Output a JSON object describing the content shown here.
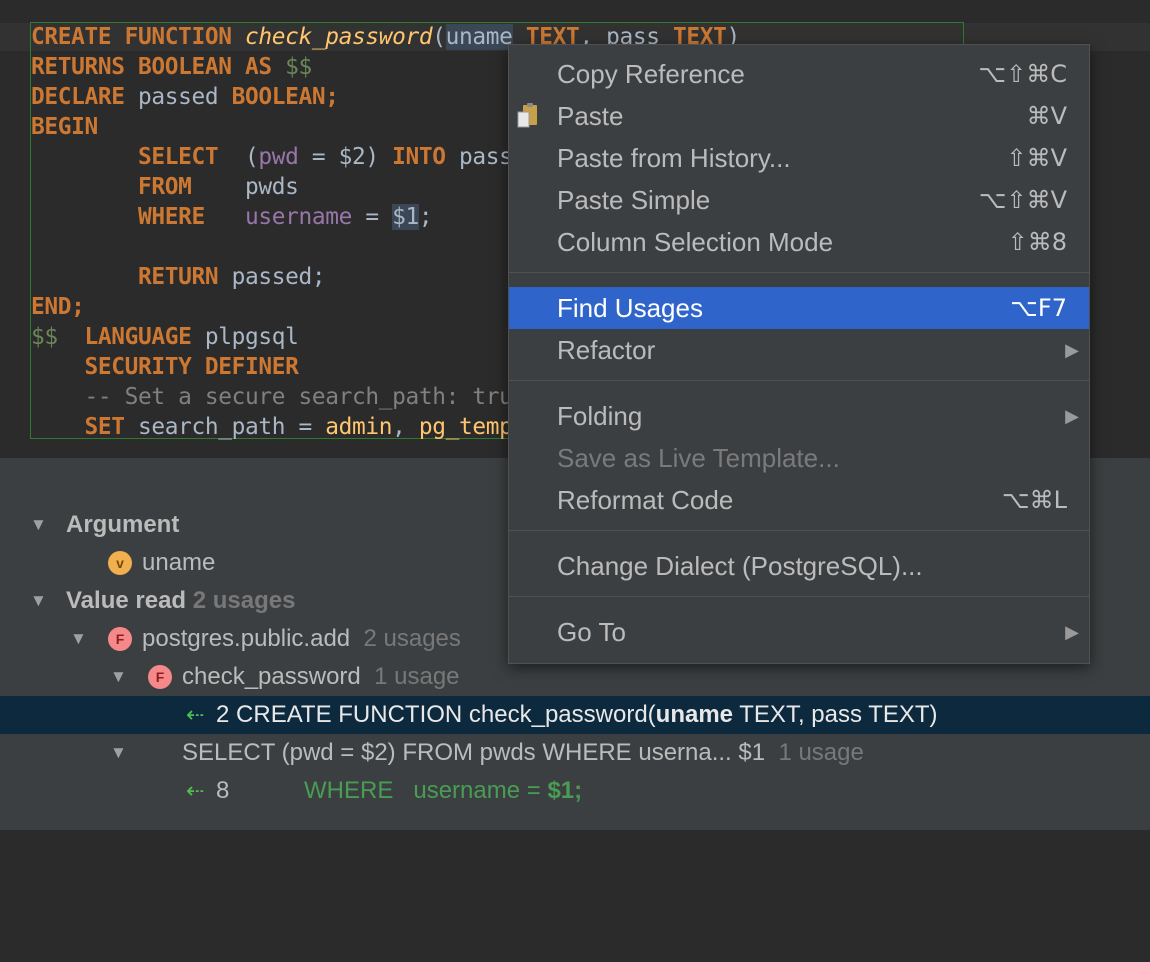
{
  "editor": {
    "lines": [
      {
        "kw1": "CREATE FUNCTION",
        "fn": "check_password",
        "p1": "(",
        "param": "uname",
        "kw2": "TEXT",
        "p2": ", pass ",
        "kw3": "TEXT",
        "p3": ")"
      },
      {
        "kw1": "RETURNS BOOLEAN AS",
        "dollar": "$$"
      },
      {
        "kw1": "DECLARE",
        "txt": "passed",
        "kw2": "BOOLEAN;"
      },
      {
        "kw1": "BEGIN"
      },
      {
        "kw1": "SELECT",
        "p1": "(",
        "col": "pwd",
        "p2": " = $2) ",
        "kw2": "INTO",
        "txt": " passed"
      },
      {
        "kw1": "FROM",
        "txt": "pwds"
      },
      {
        "kw1": "WHERE",
        "col": "username",
        "p1": " = ",
        "arg": "$1",
        "p2": ";"
      },
      {
        "kw1": "RETURN",
        "txt": "passed;"
      },
      {
        "kw1": "END;"
      },
      {
        "dollar": "$$",
        "kw1": "LANGUAGE",
        "txt": "plpgsql"
      },
      {
        "kw1": "SECURITY DEFINER"
      },
      {
        "cmt": "-- Set a secure search_path: trusted schema(s), then 'pg_temp'."
      },
      {
        "kw1": "SET",
        "txt": "search_path = ",
        "fn1": "admin",
        "p1": ", ",
        "fn2": "pg_temp",
        "p2": ";"
      }
    ]
  },
  "tree": {
    "argument_label": "Argument",
    "argument_item": "uname",
    "value_read_label": "Value read",
    "value_read_count": "2 usages",
    "func_add_name": "postgres.public.add",
    "func_add_count": "2 usages",
    "func_check_name": "check_password",
    "func_check_count": "1 usage",
    "usage1_line": "2",
    "usage1_pre": " CREATE FUNCTION check_password(",
    "usage1_bold": "uname",
    "usage1_post": " TEXT, pass TEXT)",
    "select_text": "SELECT (pwd = $2) FROM pwds WHERE userna... $1",
    "select_count": "1 usage",
    "usage2_line": "8",
    "usage2_where": "WHERE",
    "usage2_text": "username = ",
    "usage2_bold": "$1;"
  },
  "menu": {
    "items": [
      {
        "label": "Copy Reference",
        "shortcut": "⌥⇧⌘C"
      },
      {
        "label": "Paste",
        "shortcut": "⌘V"
      },
      {
        "label": "Paste from History...",
        "shortcut": "⇧⌘V"
      },
      {
        "label": "Paste Simple",
        "shortcut": "⌥⇧⌘V"
      },
      {
        "label": "Column Selection Mode",
        "shortcut": "⇧⌘8"
      },
      {
        "label": "Find Usages",
        "shortcut": "⌥F7"
      },
      {
        "label": "Refactor"
      },
      {
        "label": "Folding"
      },
      {
        "label": "Save as Live Template..."
      },
      {
        "label": "Reformat Code",
        "shortcut": "⌥⌘L"
      },
      {
        "label": "Change Dialect (PostgreSQL)..."
      },
      {
        "label": "Go To"
      }
    ],
    "submenu_arrow": "▶"
  },
  "colors": {
    "menu_highlight": "#2f65ca",
    "selected_row": "#0d293e",
    "keyword": "#cc7832",
    "function": "#ffc66d"
  }
}
